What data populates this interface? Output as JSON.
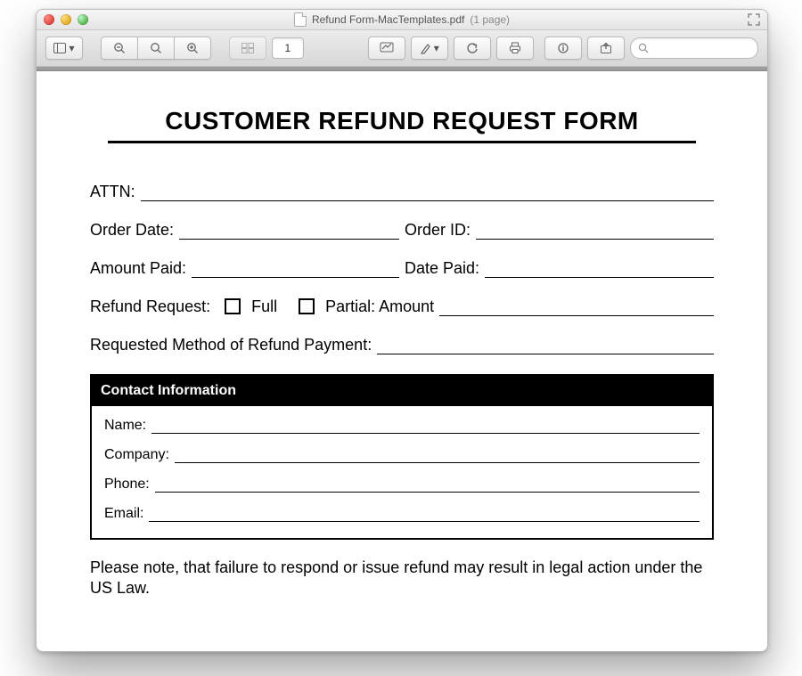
{
  "window": {
    "filename": "Refund Form-MacTemplates.pdf",
    "page_suffix": "(1 page)"
  },
  "toolbar": {
    "page_number": "1",
    "search_placeholder": ""
  },
  "form": {
    "title": "CUSTOMER REFUND REQUEST FORM",
    "attn_label": "ATTN:",
    "order_date_label": "Order Date:",
    "order_id_label": "Order ID:",
    "amount_paid_label": "Amount Paid:",
    "date_paid_label": "Date Paid:",
    "refund_request_label": "Refund Request:",
    "full_label": "Full",
    "partial_label": "Partial: Amount",
    "method_label": "Requested Method of Refund Payment:",
    "contact_section_title": "Contact Information",
    "name_label": "Name:",
    "company_label": "Company:",
    "phone_label": "Phone:",
    "email_label": "Email:",
    "note": "Please note, that failure to respond or issue refund may result in legal action under the US Law."
  }
}
